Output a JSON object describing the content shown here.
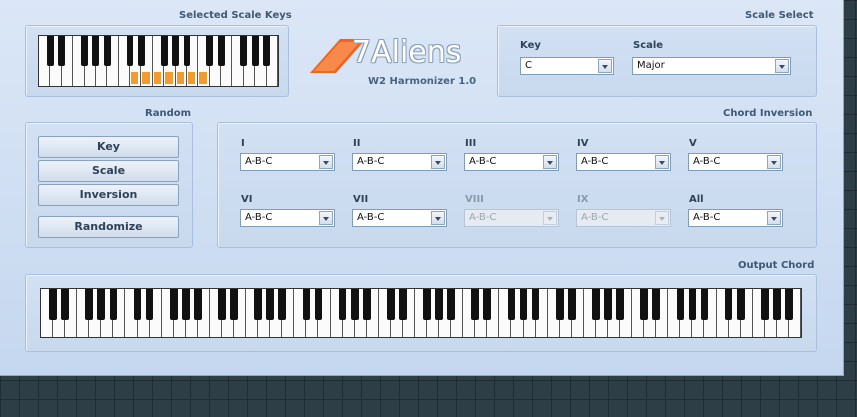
{
  "app": {
    "brand_mark": "7",
    "brand_name": "Aliens",
    "product": "W2 Harmonizer 1.0"
  },
  "scale_keys": {
    "title": "Selected Scale Keys",
    "highlighted_white_keys": [
      8,
      9,
      10,
      11,
      12,
      13,
      14
    ]
  },
  "scale_select": {
    "title": "Scale Select",
    "key_label": "Key",
    "key_value": "C",
    "scale_label": "Scale",
    "scale_value": "Major"
  },
  "random": {
    "title": "Random",
    "buttons": [
      "Key",
      "Scale",
      "Inversion",
      "Randomize"
    ]
  },
  "chord_inversion": {
    "title": "Chord Inversion",
    "rows": [
      [
        {
          "label": "I",
          "value": "A-B-C",
          "enabled": true
        },
        {
          "label": "II",
          "value": "A-B-C",
          "enabled": true
        },
        {
          "label": "III",
          "value": "A-B-C",
          "enabled": true
        },
        {
          "label": "IV",
          "value": "A-B-C",
          "enabled": true
        },
        {
          "label": "V",
          "value": "A-B-C",
          "enabled": true
        }
      ],
      [
        {
          "label": "VI",
          "value": "A-B-C",
          "enabled": true
        },
        {
          "label": "VII",
          "value": "A-B-C",
          "enabled": true
        },
        {
          "label": "VIII",
          "value": "A-B-C",
          "enabled": false
        },
        {
          "label": "IX",
          "value": "A-B-C",
          "enabled": false
        },
        {
          "label": "All",
          "value": "A-B-C",
          "enabled": true
        }
      ]
    ]
  },
  "output_chord": {
    "title": "Output Chord"
  },
  "colors": {
    "panel_bg": "#c8d9ee",
    "highlight_key": "#f39b2e",
    "logo_orange": "#f0641e"
  }
}
